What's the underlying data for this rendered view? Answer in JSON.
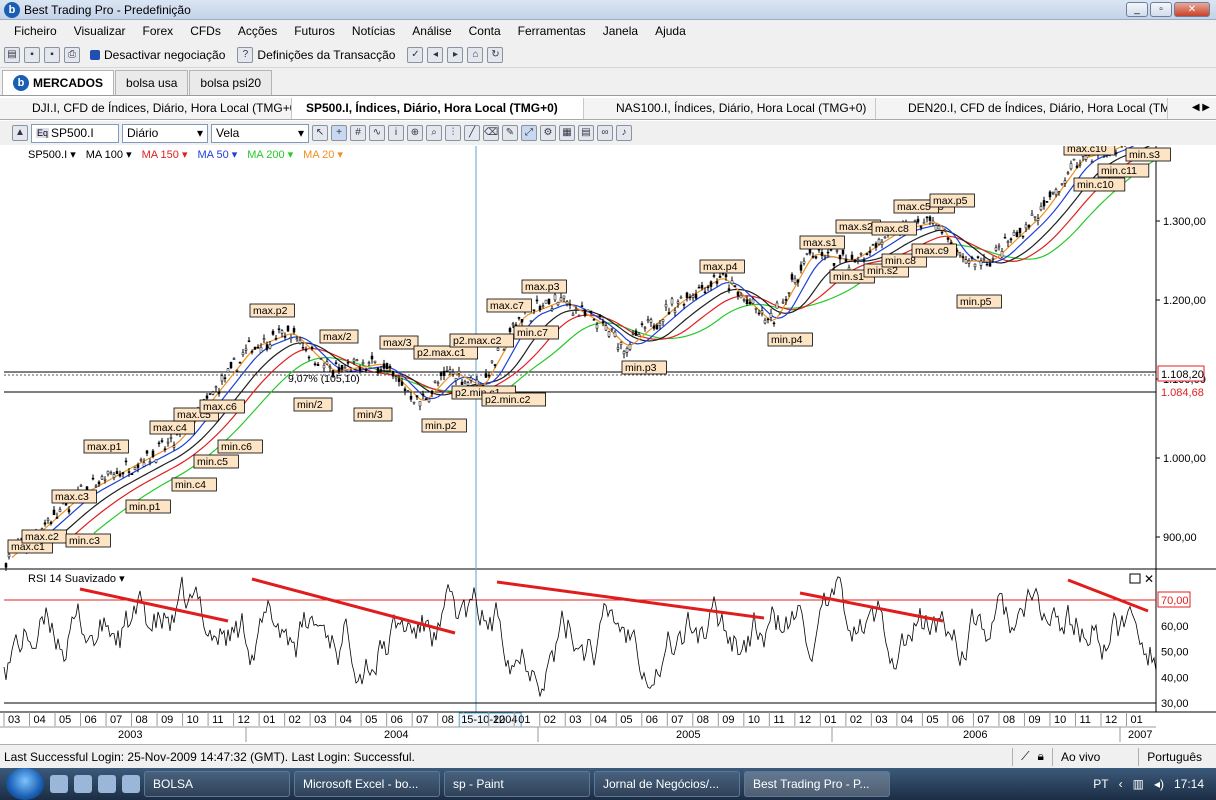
{
  "window": {
    "title": "Best Trading Pro - Predefinição",
    "app_icon": "b"
  },
  "menu": [
    "Ficheiro",
    "Visualizar",
    "Forex",
    "CFDs",
    "Acções",
    "Futuros",
    "Notícias",
    "Análise",
    "Conta",
    "Ferramentas",
    "Janela",
    "Ajuda"
  ],
  "toolbar": {
    "deactivate_label": "Desactivar negociação",
    "settings_label": "Definições da Transacção"
  },
  "workspace_tabs": [
    "MERCADOS",
    "bolsa usa",
    "bolsa psi20"
  ],
  "chart_tabs": [
    "DJI.I, CFD de Índices, Diário, Hora Local (TMG+0)",
    "SP500.I, Índices, Diário, Hora Local (TMG+0)",
    "NAS100.I, Índices, Diário, Hora Local (TMG+0)",
    "DEN20.I, CFD de Índices, Diário, Hora Local (TMG+0)"
  ],
  "chart_toolbar": {
    "symbol": "SP500.I",
    "period": "Diário",
    "chart_style": "Vela",
    "symbol_icon": "Eq"
  },
  "studies": [
    {
      "label": "SP500.I",
      "color": "#000000"
    },
    {
      "label": "MA 100",
      "color": "#000000"
    },
    {
      "label": "MA 150",
      "color": "#e02020"
    },
    {
      "label": "MA 50",
      "color": "#1f3fd8"
    },
    {
      "label": "MA 200",
      "color": "#28c828"
    },
    {
      "label": "MA 20",
      "color": "#f09020"
    }
  ],
  "price_axis": {
    "ticks": [
      "1.300,00",
      "1.200,00",
      "1.100,00",
      "1.000,00",
      "900,00"
    ],
    "current": "1.108,20",
    "marker": "1.084,68"
  },
  "annotations": {
    "labels": [
      "max.c1",
      "max.c2",
      "max.c3",
      "min.c3",
      "max.p1",
      "min.p1",
      "max.c4",
      "max.c5",
      "min.c4",
      "min.c5",
      "max.c6",
      "min.c6",
      "max.p2",
      "max/2",
      "min/2",
      "max/3",
      "min/3",
      "p2.max.c1",
      "p2.max.c2",
      "min.p2",
      "p2.min.c1",
      "p2.min.c2",
      "max.c7",
      "min.c7",
      "max.p3",
      "min.p3",
      "max.p4",
      "min.p4",
      "max.s1",
      "min.s1",
      "max.s2",
      "min.s2",
      "max.c8",
      "min.c8",
      "max.c9",
      "min.c9",
      "max.c5",
      "max.p5",
      "min.p5",
      "max.c10",
      "min.c10",
      "min.c11",
      "min.s3"
    ],
    "fib_text": "9,07% (105,10)"
  },
  "rsi": {
    "title": "RSI 14 Suavizado",
    "ticks": [
      "70,00",
      "60,00",
      "50,00",
      "40,00",
      "30,00"
    ],
    "overbought_label": "70,00"
  },
  "time_axis": {
    "months": [
      "03",
      "04",
      "05",
      "06",
      "07",
      "08",
      "09",
      "10",
      "11",
      "12",
      "01",
      "02",
      "03",
      "04",
      "05",
      "06",
      "07",
      "08",
      "15-10-2004",
      "12",
      "01",
      "02",
      "03",
      "04",
      "05",
      "06",
      "07",
      "08",
      "09",
      "10",
      "11",
      "12",
      "01",
      "02",
      "03",
      "04",
      "05",
      "06",
      "07",
      "08",
      "09",
      "10",
      "11",
      "12",
      "01"
    ],
    "years": [
      "2003",
      "2004",
      "2005",
      "2006",
      "2007"
    ],
    "crosshair_date": "15-10-2004"
  },
  "status": {
    "login_text": "Last Successful Login: 25-Nov-2009 14:47:32 (GMT). Last Login: Successful.",
    "live": "Ao vivo",
    "language": "Português"
  },
  "taskbar": {
    "tasks": [
      "BOLSA",
      "Microsoft Excel - bo...",
      "sp - Paint",
      "Jornal de Negócios/...",
      "Best Trading Pro - P..."
    ],
    "lang": "PT",
    "time": "17:14"
  },
  "colors": {
    "ma20": "#f09020",
    "ma50": "#1f3fd8",
    "ma100": "#202020",
    "ma150": "#e02020",
    "ma200": "#28c828",
    "trendline": "#e01c1c",
    "label_bg": "#fce4c4"
  }
}
